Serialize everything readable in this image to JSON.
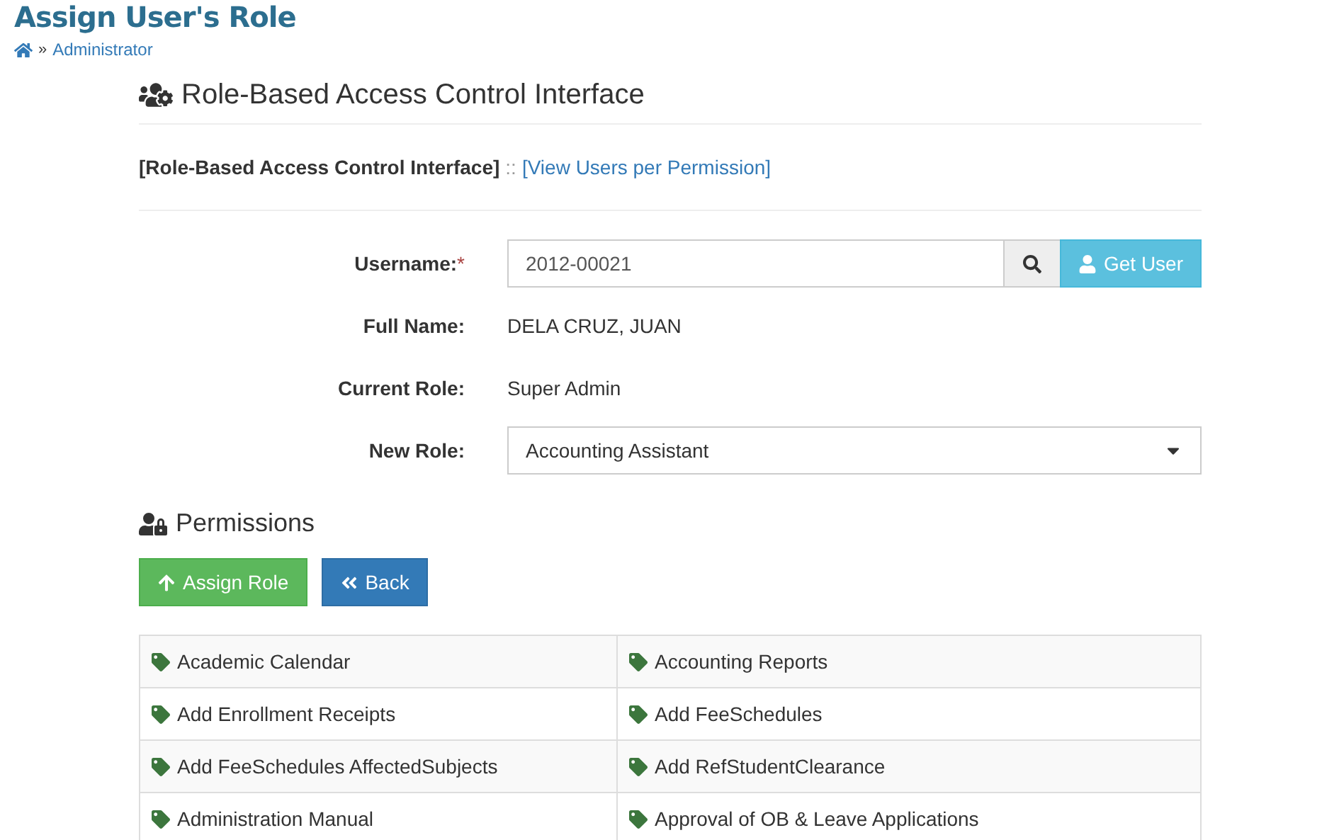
{
  "page": {
    "title": "Assign User's Role",
    "breadcrumb": {
      "separator": "»",
      "items": [
        "Administrator"
      ]
    }
  },
  "section": {
    "title": "Role-Based Access Control Interface",
    "nav": [
      {
        "label": "[Role-Based Access Control Interface]",
        "selected": true
      },
      {
        "label": "[View Users per Permission]",
        "selected": false
      }
    ],
    "nav_separator": "::"
  },
  "form": {
    "fields": [
      {
        "kind": "search",
        "label": "Username:",
        "required_mark": "*",
        "value": "2012-00021",
        "button": "Get User"
      },
      {
        "kind": "text",
        "label": "Full Name:",
        "value": "DELA CRUZ, JUAN"
      },
      {
        "kind": "text",
        "label": "Current Role:",
        "value": "Super Admin"
      },
      {
        "kind": "select",
        "label": "New Role:",
        "value": "Accounting Assistant"
      }
    ]
  },
  "permissions": {
    "title": "Permissions",
    "buttons": [
      {
        "kind": "success",
        "label": "Assign Role"
      },
      {
        "kind": "primary",
        "label": "Back"
      }
    ],
    "rows": [
      [
        "Academic Calendar",
        "Accounting Reports"
      ],
      [
        "Add Enrollment Receipts",
        "Add FeeSchedules"
      ],
      [
        "Add FeeSchedules AffectedSubjects",
        "Add RefStudentClearance"
      ],
      [
        "Administration Manual",
        "Approval of OB & Leave Applications"
      ]
    ]
  }
}
